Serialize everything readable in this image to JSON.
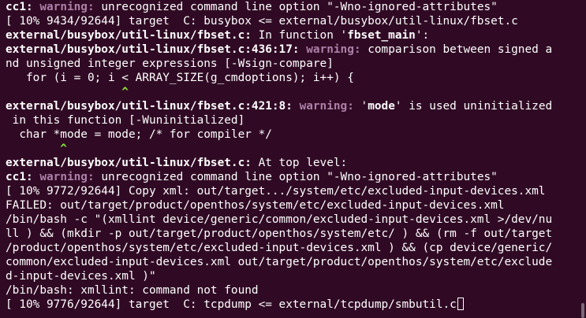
{
  "lines": [
    [
      {
        "t": "cc1: ",
        "s": "bold"
      },
      {
        "t": "warning: ",
        "s": "warn"
      },
      {
        "t": "unrecognized command line option \"-Wno-ignored-attributes\"",
        "s": ""
      }
    ],
    [
      {
        "t": "[ 10% 9434/92644] target  C: busybox <= external/busybox/util-linux/fbset.c",
        "s": ""
      }
    ],
    [
      {
        "t": "external/busybox/util-linux/fbset.c:",
        "s": "bold"
      },
      {
        "t": " In function '",
        "s": ""
      },
      {
        "t": "fbset_main",
        "s": "bold"
      },
      {
        "t": "':",
        "s": ""
      }
    ],
    [
      {
        "t": "external/busybox/util-linux/fbset.c:436:17: ",
        "s": "bold"
      },
      {
        "t": "warning: ",
        "s": "warn"
      },
      {
        "t": "comparison between signed a",
        "s": ""
      }
    ],
    [
      {
        "t": "nd unsigned integer expressions [-Wsign-compare]",
        "s": ""
      }
    ],
    [
      {
        "t": "   for (i = 0; i < ARRAY_SIZE(g_cmdoptions); i++) {",
        "s": ""
      }
    ],
    [
      {
        "t": "                 ^",
        "s": "caret"
      }
    ],
    [
      {
        "t": "external/busybox/util-linux/fbset.c:421:8: ",
        "s": "bold"
      },
      {
        "t": "warning: ",
        "s": "warn"
      },
      {
        "t": "'",
        "s": ""
      },
      {
        "t": "mode",
        "s": "bold"
      },
      {
        "t": "' is used uninitialized",
        "s": ""
      }
    ],
    [
      {
        "t": " in this function [-Wuninitialized]",
        "s": ""
      }
    ],
    [
      {
        "t": "  char *mode = mode; /* for compiler */",
        "s": ""
      }
    ],
    [
      {
        "t": "        ^",
        "s": "caret"
      }
    ],
    [
      {
        "t": "external/busybox/util-linux/fbset.c:",
        "s": "bold"
      },
      {
        "t": " At top level:",
        "s": ""
      }
    ],
    [
      {
        "t": "cc1: ",
        "s": "bold"
      },
      {
        "t": "warning: ",
        "s": "warn"
      },
      {
        "t": "unrecognized command line option \"-Wno-ignored-attributes\"",
        "s": ""
      }
    ],
    [
      {
        "t": "[ 10% 9772/92644] Copy xml: out/target.../system/etc/excluded-input-devices.xml",
        "s": ""
      }
    ],
    [
      {
        "t": "FAILED: out/target/product/openthos/system/etc/excluded-input-devices.xml",
        "s": ""
      }
    ],
    [
      {
        "t": "/bin/bash -c \"(xmllint device/generic/common/excluded-input-devices.xml >/dev/nu",
        "s": ""
      }
    ],
    [
      {
        "t": "ll ) && (mkdir -p out/target/product/openthos/system/etc/ ) && (rm -f out/target",
        "s": ""
      }
    ],
    [
      {
        "t": "/product/openthos/system/etc/excluded-input-devices.xml ) && (cp device/generic/",
        "s": ""
      }
    ],
    [
      {
        "t": "common/excluded-input-devices.xml out/target/product/openthos/system/etc/exclude",
        "s": ""
      }
    ],
    [
      {
        "t": "d-input-devices.xml )\"",
        "s": ""
      }
    ],
    [
      {
        "t": "/bin/bash: xmllint: command not found",
        "s": ""
      }
    ],
    [
      {
        "t": "[ 10% 9776/92644] target  C: tcpdump <= external/tcpdump/smbutil.c",
        "s": ""
      }
    ]
  ],
  "colors": {
    "background": "#300a24",
    "foreground": "#ffffff",
    "warning": "#ad7fa8",
    "caret": "#8ae234"
  },
  "cursor_icon": "block-cursor-icon"
}
